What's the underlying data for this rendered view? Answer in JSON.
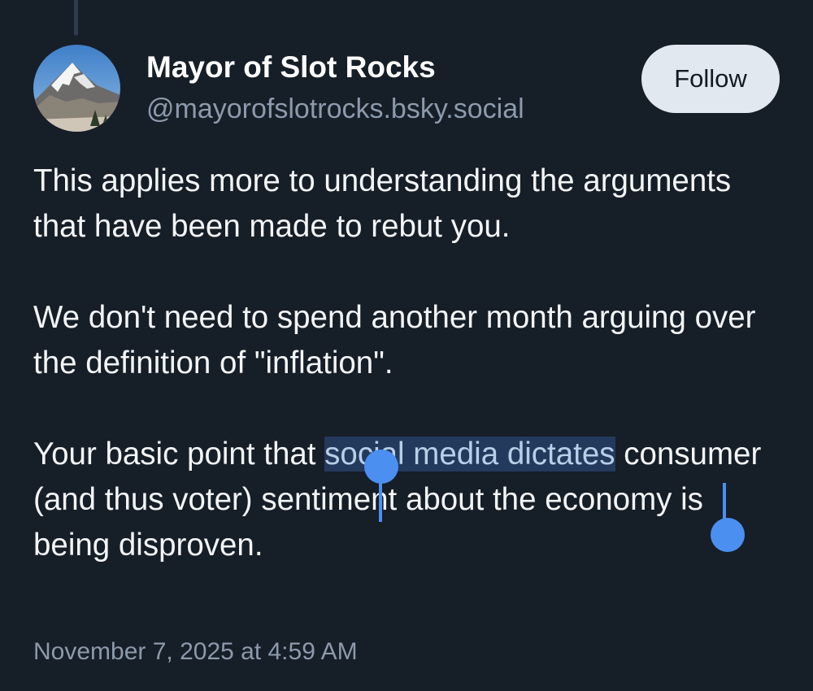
{
  "post": {
    "author": {
      "display_name": "Mayor of Slot Rocks",
      "handle": "@mayorofslotrocks.bsky.social"
    },
    "follow_label": "Follow",
    "paragraphs": {
      "p1": "This applies more to understanding the arguments that have been made to rebut you.",
      "p2": "We don't need to spend another month arguing over the definition of \"inflation\".",
      "p3_before": "Your basic point that ",
      "p3_selected": "social media dictates",
      "p3_after": " consumer (and thus voter) sentiment about the economy is being disproven."
    },
    "timestamp": "November 7, 2025 at 4:59 AM"
  },
  "colors": {
    "background": "#161e27",
    "text": "#f3f5f7",
    "muted": "#8c9aab",
    "selection_handle": "#4b8ff1",
    "selection_fill": "#233a5d"
  },
  "icons": {
    "avatar": "mountain-avatar"
  }
}
